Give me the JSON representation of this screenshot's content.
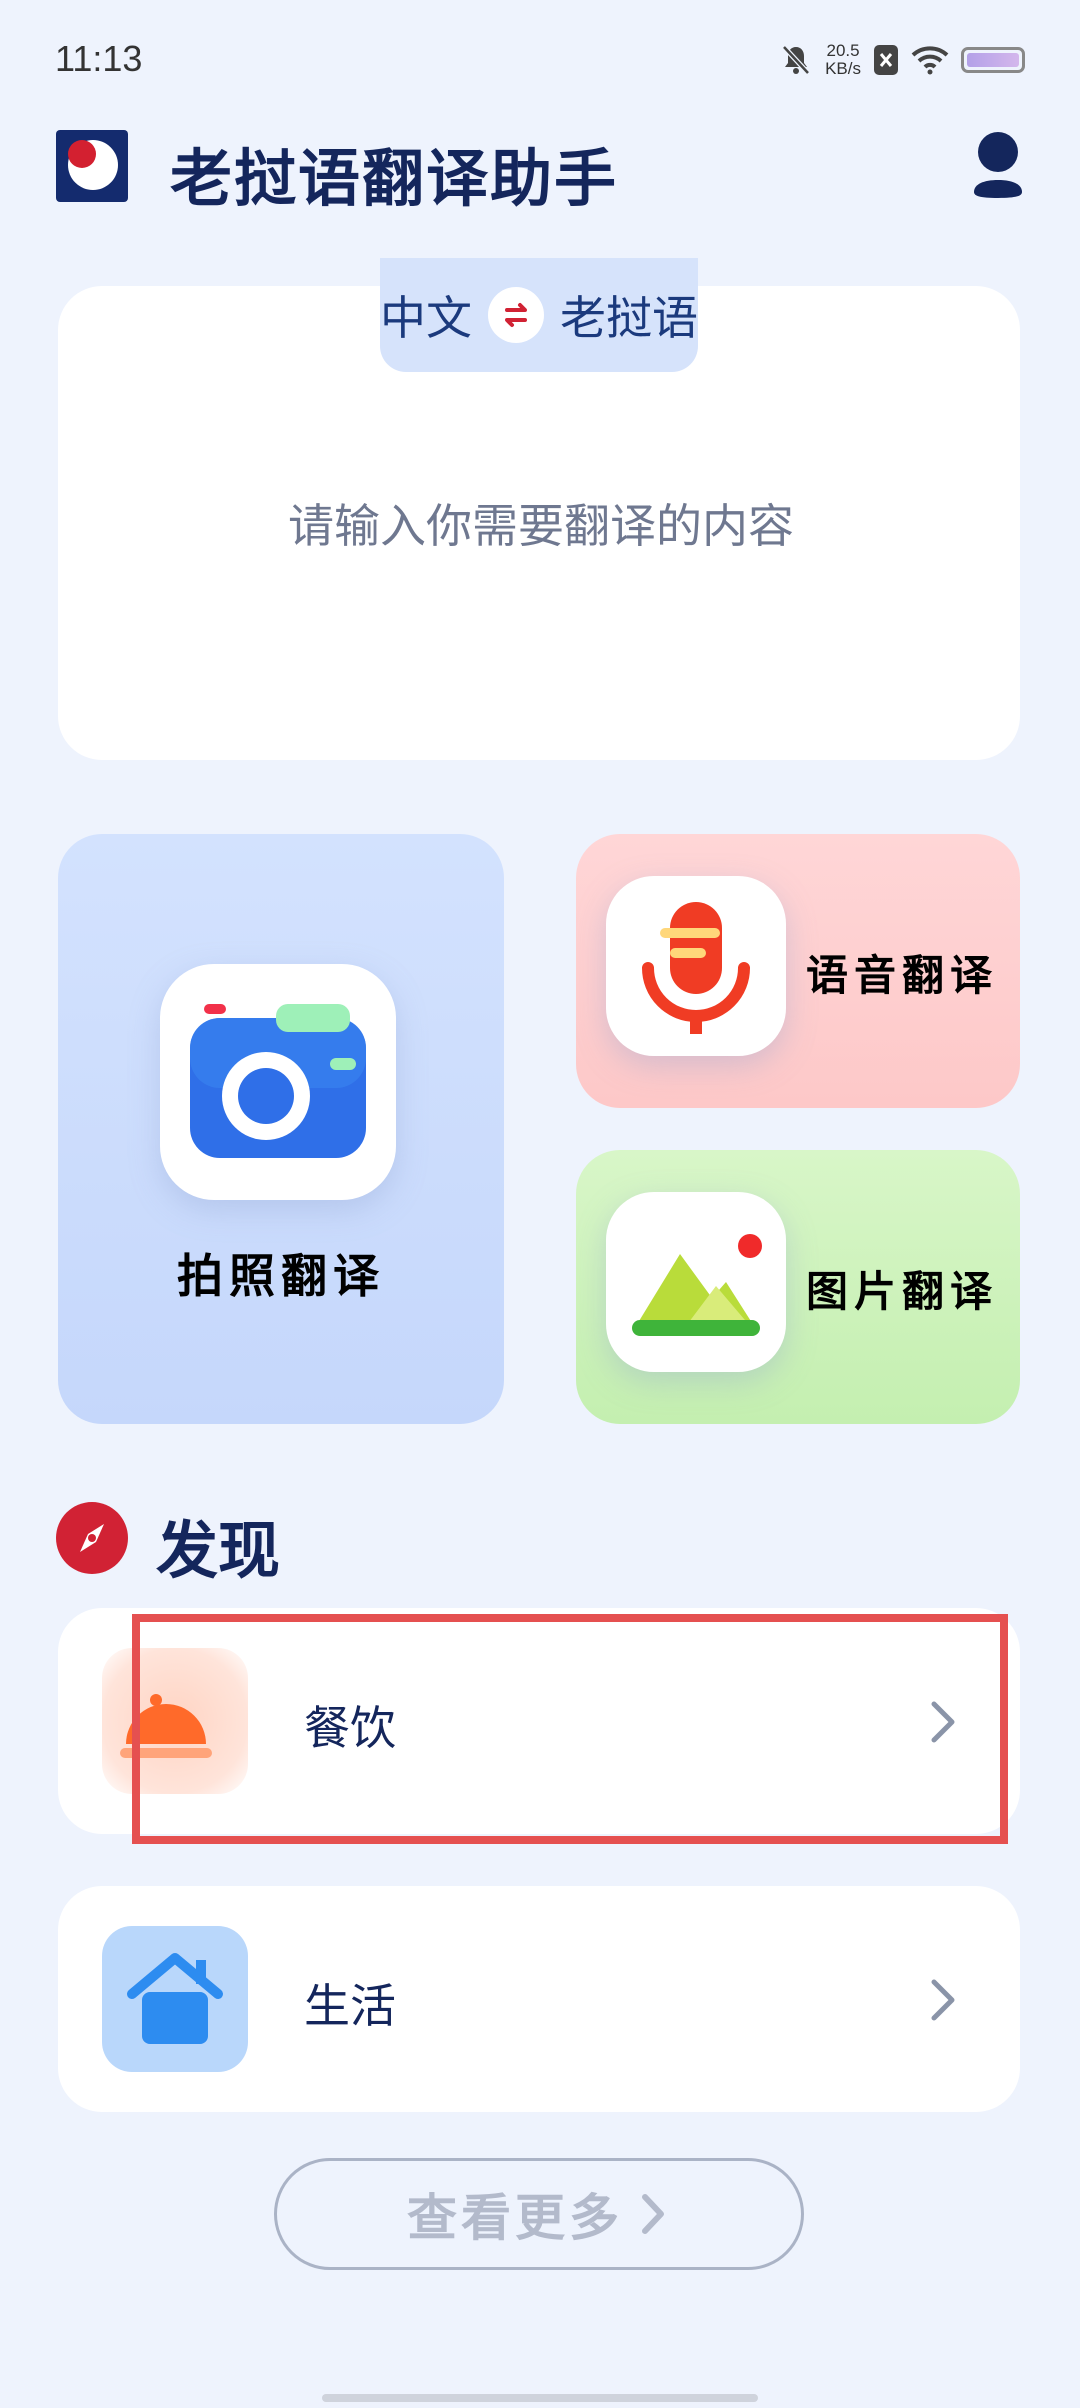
{
  "status_bar": {
    "time": "11:13",
    "net_speed_value": "20.5",
    "net_speed_unit": "KB/s"
  },
  "header": {
    "title": "老挝语翻译助手"
  },
  "translator": {
    "source_lang": "中文",
    "target_lang": "老挝语",
    "input_placeholder": "请输入你需要翻译的内容",
    "input_value": ""
  },
  "features": {
    "camera_label": "拍照翻译",
    "voice_label": "语音翻译",
    "image_label": "图片翻译"
  },
  "discover": {
    "title": "发现",
    "items": [
      {
        "label": "餐饮",
        "icon": "dining-bell-icon"
      },
      {
        "label": "生活",
        "icon": "house-icon"
      }
    ],
    "more_label": "查看更多"
  },
  "colors": {
    "background": "#eef3fd",
    "title": "#14265c",
    "accent_red": "#d12234",
    "highlight": "#e55050"
  }
}
